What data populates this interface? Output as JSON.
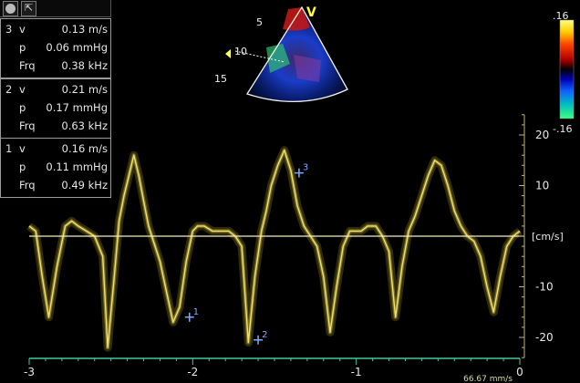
{
  "toolbar": {
    "icons": [
      "record-icon",
      "cursor-select-icon"
    ]
  },
  "measurements": [
    {
      "index": "3",
      "v_label": "v",
      "v_value": "0.13 m/s",
      "p_label": "p",
      "p_value": "0.06 mmHg",
      "f_label": "Frq",
      "f_value": "0.38 kHz"
    },
    {
      "index": "2",
      "v_label": "v",
      "v_value": "0.21 m/s",
      "p_label": "p",
      "p_value": "0.17 mmHg",
      "f_label": "Frq",
      "f_value": "0.63 kHz"
    },
    {
      "index": "1",
      "v_label": "v",
      "v_value": "0.16 m/s",
      "p_label": "p",
      "p_value": "0.11 mmHg",
      "f_label": "Frq",
      "f_value": "0.49 kHz"
    }
  ],
  "sector": {
    "mode_label": "V",
    "depth_labels": [
      "5",
      "10",
      "15"
    ]
  },
  "color_scale": {
    "top": ".16",
    "bottom": "-.16",
    "colors": [
      "#ffff80",
      "#ffcc00",
      "#ff4000",
      "#b00000",
      "#000000",
      "#0000b0",
      "#1060ff",
      "#00c0c0",
      "#40ff80"
    ]
  },
  "chart_data": {
    "type": "line",
    "title": "",
    "xlabel": "",
    "ylabel": "[cm/s]",
    "xlim": [
      -3,
      0
    ],
    "ylim": [
      -24,
      24
    ],
    "x_ticks": [
      -3,
      -2,
      -1,
      0
    ],
    "x_tick_labels": [
      "-3",
      "-2",
      "-1",
      "0"
    ],
    "y_ticks": [
      20,
      10,
      -10,
      -20
    ],
    "y_tick_labels": [
      "20",
      "10",
      "-10",
      "-20"
    ],
    "baseline_label": "[cm/s]",
    "sweep_speed": "66.67 mm/s",
    "trace_color": "#d6c23a",
    "axis_color": "#40c8a0",
    "series": [
      {
        "x": [
          -3.0,
          -2.96,
          -2.92,
          -2.88,
          -2.83,
          -2.78,
          -2.74,
          -2.7,
          -2.65,
          -2.6,
          -2.55,
          -2.52,
          -2.48,
          -2.45,
          -2.42,
          -2.39,
          -2.36,
          -2.33,
          -2.3,
          -2.27,
          -2.24,
          -2.2,
          -2.16,
          -2.12,
          -2.08,
          -2.04,
          -2.0,
          -1.97,
          -1.93,
          -1.88,
          -1.83,
          -1.78,
          -1.74,
          -1.7,
          -1.66,
          -1.62,
          -1.58,
          -1.55,
          -1.52,
          -1.48,
          -1.44,
          -1.4,
          -1.36,
          -1.32,
          -1.28,
          -1.24,
          -1.2,
          -1.16,
          -1.12,
          -1.08,
          -1.04,
          -1.0,
          -0.97,
          -0.93,
          -0.88,
          -0.84,
          -0.8,
          -0.76,
          -0.72,
          -0.68,
          -0.64,
          -0.6,
          -0.56,
          -0.52,
          -0.48,
          -0.44,
          -0.4,
          -0.36,
          -0.32,
          -0.28,
          -0.24,
          -0.2,
          -0.16,
          -0.12,
          -0.08,
          -0.04,
          0.0
        ],
        "y": [
          2,
          1,
          -8,
          -16,
          -6,
          2,
          3,
          2,
          1,
          0,
          -4,
          -22,
          -8,
          3,
          8,
          12,
          16,
          12,
          7,
          2,
          -1,
          -5,
          -11,
          -17,
          -14,
          -5,
          1,
          2,
          2,
          1,
          1,
          1,
          0,
          -2,
          -21,
          -8,
          1,
          5,
          10,
          14,
          17,
          13,
          6,
          2,
          0,
          -2,
          -8,
          -19,
          -10,
          -2,
          1,
          1,
          1,
          2,
          2,
          0,
          -3,
          -16,
          -6,
          1,
          4,
          8,
          12,
          15,
          14,
          10,
          5,
          2,
          0,
          -1,
          -4,
          -10,
          -15,
          -8,
          -2,
          0,
          1
        ]
      }
    ],
    "markers": [
      {
        "label": "1",
        "x": -2.02,
        "y": -16
      },
      {
        "label": "2",
        "x": -1.6,
        "y": -20.5
      },
      {
        "label": "3",
        "x": -1.35,
        "y": 12.5
      }
    ]
  }
}
